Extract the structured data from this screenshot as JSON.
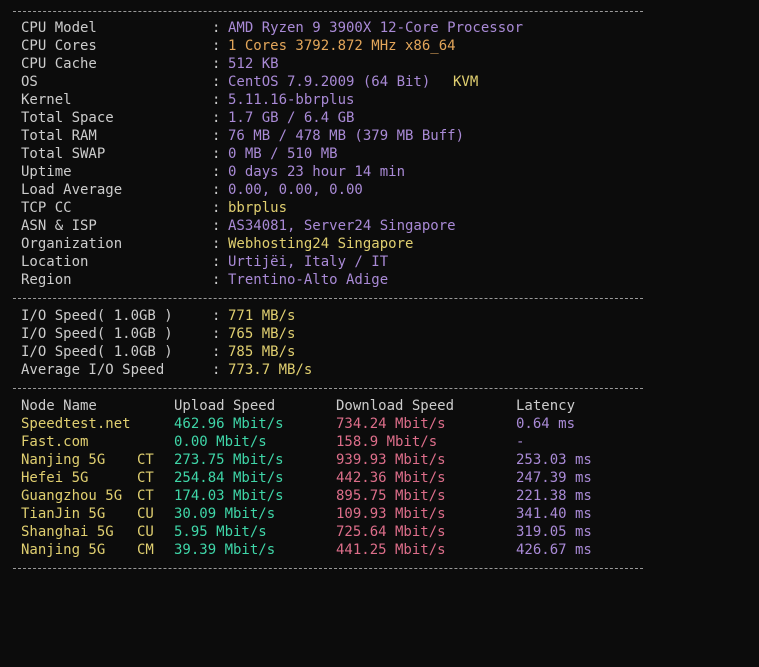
{
  "separator": "--------------------------------------------------------------------------------",
  "system": [
    {
      "label": "CPU Model",
      "value": "AMD Ryzen 9 3900X 12-Core Processor",
      "value_parts": []
    },
    {
      "label": "CPU Cores",
      "value": "1 Cores 3792.872 MHz x86_64",
      "value_parts": []
    },
    {
      "label": "CPU Cache",
      "value": "512 KB",
      "value_parts": []
    },
    {
      "label": "OS",
      "value": "CentOS 7.9.2009 (64 Bit)",
      "extra": "KVM"
    },
    {
      "label": "Kernel",
      "value": "5.11.16-bbrplus"
    },
    {
      "label": "Total Space",
      "value": "1.7 GB / 6.4 GB"
    },
    {
      "label": "Total RAM",
      "value": "76 MB / 478 MB (379 MB Buff)"
    },
    {
      "label": "Total SWAP",
      "value": "0 MB / 510 MB"
    },
    {
      "label": "Uptime",
      "value": "0 days 23 hour 14 min"
    },
    {
      "label": "Load Average",
      "value": "0.00, 0.00, 0.00"
    },
    {
      "label": "TCP CC",
      "value": "bbrplus"
    },
    {
      "label": "ASN & ISP",
      "value": "AS34081, Server24 Singapore"
    },
    {
      "label": "Organization",
      "value": "Webhosting24 Singapore"
    },
    {
      "label": "Location",
      "value": "Urtijëi, Italy / IT"
    },
    {
      "label": "Region",
      "value": "Trentino-Alto Adige"
    }
  ],
  "io": [
    {
      "label": "I/O Speed( 1.0GB )",
      "value": "771 MB/s"
    },
    {
      "label": "I/O Speed( 1.0GB )",
      "value": "765 MB/s"
    },
    {
      "label": "I/O Speed( 1.0GB )",
      "value": "785 MB/s"
    },
    {
      "label": "Average I/O Speed",
      "value": "773.7 MB/s"
    }
  ],
  "colon": ":",
  "speedtest": {
    "headers": {
      "node": "Node Name",
      "upload": "Upload Speed",
      "download": "Download Speed",
      "latency": "Latency"
    },
    "rows": [
      {
        "node": "Speedtest.net",
        "isp": "",
        "upload": "462.96 Mbit/s",
        "download": "734.24 Mbit/s",
        "latency": "0.64 ms"
      },
      {
        "node": "Fast.com",
        "isp": "",
        "upload": "0.00 Mbit/s",
        "download": "158.9 Mbit/s",
        "latency": "-"
      },
      {
        "node": "Nanjing 5G",
        "isp": "CT",
        "upload": "273.75 Mbit/s",
        "download": "939.93 Mbit/s",
        "latency": "253.03 ms"
      },
      {
        "node": "Hefei 5G",
        "isp": "CT",
        "upload": "254.84 Mbit/s",
        "download": "442.36 Mbit/s",
        "latency": "247.39 ms"
      },
      {
        "node": "Guangzhou 5G",
        "isp": "CT",
        "upload": "174.03 Mbit/s",
        "download": "895.75 Mbit/s",
        "latency": "221.38 ms"
      },
      {
        "node": "TianJin 5G",
        "isp": "CU",
        "upload": "30.09 Mbit/s",
        "download": "109.93 Mbit/s",
        "latency": "341.40 ms"
      },
      {
        "node": "Shanghai 5G",
        "isp": "CU",
        "upload": "5.95 Mbit/s",
        "download": "725.64 Mbit/s",
        "latency": "319.05 ms"
      },
      {
        "node": "Nanjing 5G",
        "isp": "CM",
        "upload": "39.39 Mbit/s",
        "download": "441.25 Mbit/s",
        "latency": "426.67 ms"
      }
    ]
  },
  "colors": {
    "background": "#0c0c0c",
    "label": "#cccccc",
    "purple": "#a98ad6",
    "orange": "#e3a65a",
    "yellow": "#e0cf70",
    "green": "#3fd6a8",
    "pink": "#dd6e8a"
  }
}
